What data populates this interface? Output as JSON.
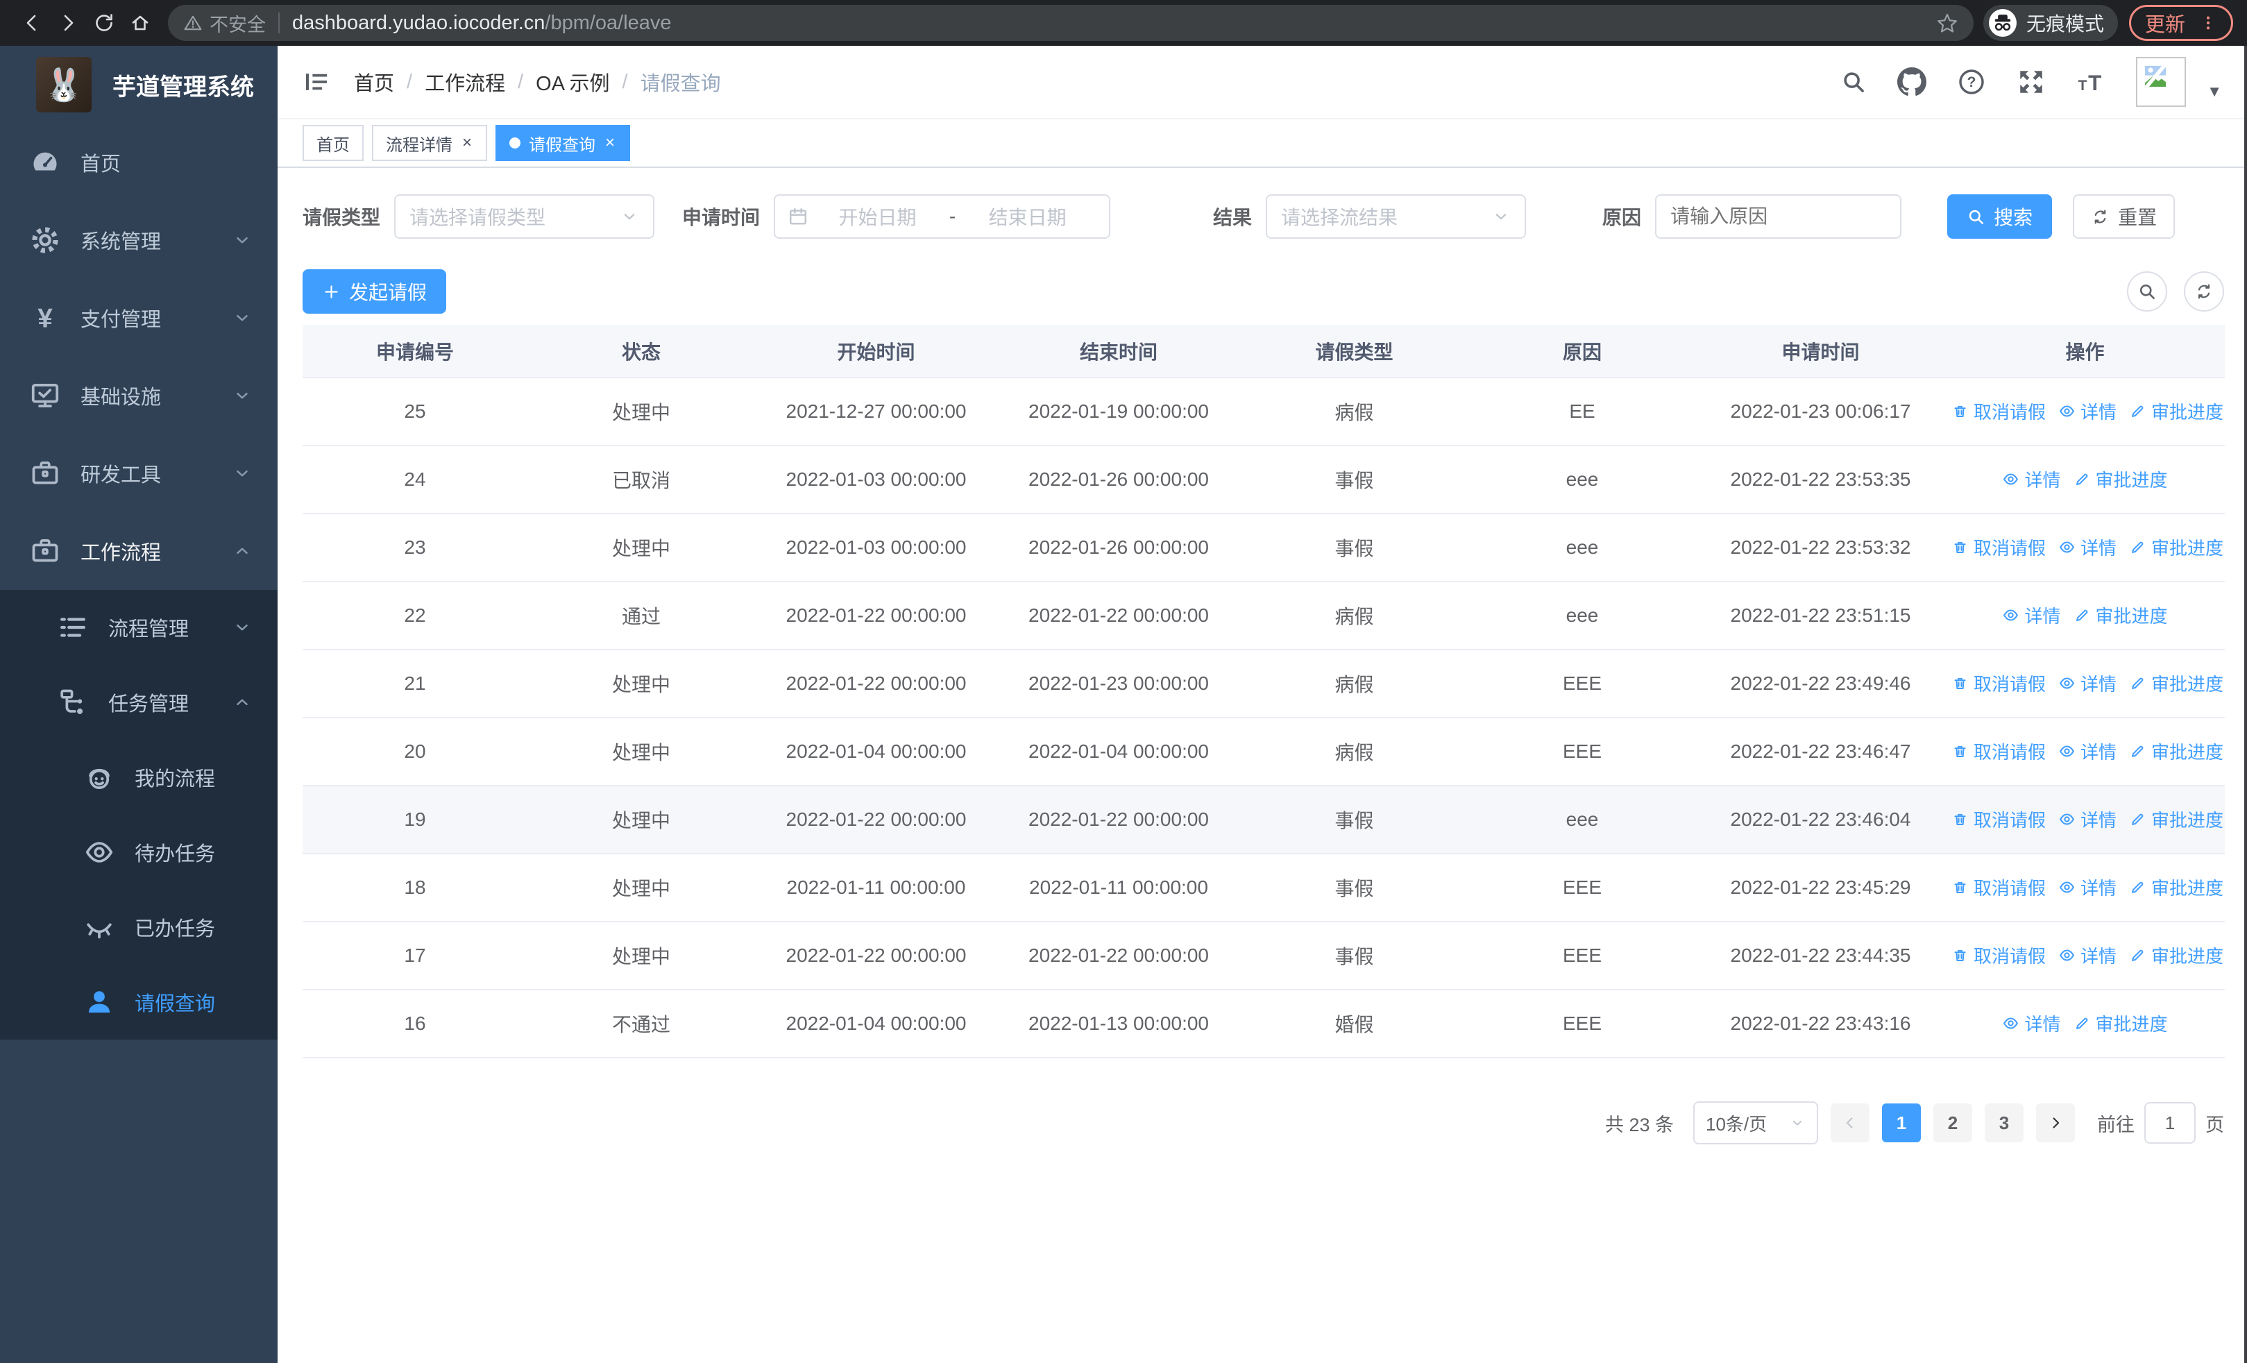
{
  "browser": {
    "security_label": "不安全",
    "url_host": "dashboard.yudao.iocoder.cn",
    "url_path": "/bpm/oa/leave",
    "incognito_label": "无痕模式",
    "update_label": "更新"
  },
  "sidebar": {
    "title": "芋道管理系统",
    "items": [
      {
        "name": "home",
        "label": "首页",
        "icon": "dashboard",
        "level": 0
      },
      {
        "name": "system-management",
        "label": "系统管理",
        "icon": "gear",
        "level": 0,
        "chevron": "down"
      },
      {
        "name": "payment-management",
        "label": "支付管理",
        "icon": "yen",
        "level": 0,
        "chevron": "down"
      },
      {
        "name": "infrastructure",
        "label": "基础设施",
        "icon": "monitor",
        "level": 0,
        "chevron": "down"
      },
      {
        "name": "dev-tools",
        "label": "研发工具",
        "icon": "briefcase",
        "level": 0,
        "chevron": "down"
      },
      {
        "name": "workflow",
        "label": "工作流程",
        "icon": "briefcase",
        "level": 0,
        "chevron": "up",
        "active_parent": true
      },
      {
        "name": "process-management",
        "label": "流程管理",
        "icon": "list",
        "level": 1,
        "chevron": "down"
      },
      {
        "name": "task-management",
        "label": "任务管理",
        "icon": "tree",
        "level": 1,
        "chevron": "up"
      },
      {
        "name": "my-process",
        "label": "我的流程",
        "icon": "face",
        "level": 2
      },
      {
        "name": "todo-tasks",
        "label": "待办任务",
        "icon": "eye",
        "level": 2
      },
      {
        "name": "done-tasks",
        "label": "已办任务",
        "icon": "eye-off",
        "level": 2
      },
      {
        "name": "leave-query",
        "label": "请假查询",
        "icon": "user",
        "level": 2,
        "active": true
      }
    ]
  },
  "header": {
    "breadcrumb": [
      "首页",
      "工作流程",
      "OA 示例",
      "请假查询"
    ]
  },
  "tabs": [
    {
      "name": "home",
      "label": "首页",
      "closable": false,
      "active": false
    },
    {
      "name": "process-detail",
      "label": "流程详情",
      "closable": true,
      "active": false
    },
    {
      "name": "leave-query",
      "label": "请假查询",
      "closable": true,
      "active": true
    }
  ],
  "filters": {
    "leave_type_label": "请假类型",
    "leave_type_placeholder": "请选择请假类型",
    "apply_time_label": "申请时间",
    "start_placeholder": "开始日期",
    "range_separator": "-",
    "end_placeholder": "结束日期",
    "result_label": "结果",
    "result_placeholder": "请选择流结果",
    "reason_label": "原因",
    "reason_placeholder": "请输入原因",
    "search_label": "搜索",
    "reset_label": "重置"
  },
  "toolbar": {
    "create_label": "发起请假"
  },
  "table": {
    "columns": [
      "申请编号",
      "状态",
      "开始时间",
      "结束时间",
      "请假类型",
      "原因",
      "申请时间",
      "操作"
    ],
    "action_labels": {
      "cancel": "取消请假",
      "detail": "详情",
      "progress": "审批进度"
    },
    "rows": [
      {
        "id": "25",
        "status": "处理中",
        "start_time": "2021-12-27 00:00:00",
        "end_time": "2022-01-19 00:00:00",
        "leave_type": "病假",
        "reason": "EE",
        "apply_time": "2022-01-23 00:06:17",
        "actions": [
          "cancel",
          "detail",
          "progress"
        ]
      },
      {
        "id": "24",
        "status": "已取消",
        "start_time": "2022-01-03 00:00:00",
        "end_time": "2022-01-26 00:00:00",
        "leave_type": "事假",
        "reason": "eee",
        "apply_time": "2022-01-22 23:53:35",
        "actions": [
          "detail",
          "progress"
        ]
      },
      {
        "id": "23",
        "status": "处理中",
        "start_time": "2022-01-03 00:00:00",
        "end_time": "2022-01-26 00:00:00",
        "leave_type": "事假",
        "reason": "eee",
        "apply_time": "2022-01-22 23:53:32",
        "actions": [
          "cancel",
          "detail",
          "progress"
        ]
      },
      {
        "id": "22",
        "status": "通过",
        "start_time": "2022-01-22 00:00:00",
        "end_time": "2022-01-22 00:00:00",
        "leave_type": "病假",
        "reason": "eee",
        "apply_time": "2022-01-22 23:51:15",
        "actions": [
          "detail",
          "progress"
        ]
      },
      {
        "id": "21",
        "status": "处理中",
        "start_time": "2022-01-22 00:00:00",
        "end_time": "2022-01-23 00:00:00",
        "leave_type": "病假",
        "reason": "EEE",
        "apply_time": "2022-01-22 23:49:46",
        "actions": [
          "cancel",
          "detail",
          "progress"
        ]
      },
      {
        "id": "20",
        "status": "处理中",
        "start_time": "2022-01-04 00:00:00",
        "end_time": "2022-01-04 00:00:00",
        "leave_type": "病假",
        "reason": "EEE",
        "apply_time": "2022-01-22 23:46:47",
        "actions": [
          "cancel",
          "detail",
          "progress"
        ]
      },
      {
        "id": "19",
        "status": "处理中",
        "start_time": "2022-01-22 00:00:00",
        "end_time": "2022-01-22 00:00:00",
        "leave_type": "事假",
        "reason": "eee",
        "apply_time": "2022-01-22 23:46:04",
        "actions": [
          "cancel",
          "detail",
          "progress"
        ],
        "highlight": true
      },
      {
        "id": "18",
        "status": "处理中",
        "start_time": "2022-01-11 00:00:00",
        "end_time": "2022-01-11 00:00:00",
        "leave_type": "事假",
        "reason": "EEE",
        "apply_time": "2022-01-22 23:45:29",
        "actions": [
          "cancel",
          "detail",
          "progress"
        ]
      },
      {
        "id": "17",
        "status": "处理中",
        "start_time": "2022-01-22 00:00:00",
        "end_time": "2022-01-22 00:00:00",
        "leave_type": "事假",
        "reason": "EEE",
        "apply_time": "2022-01-22 23:44:35",
        "actions": [
          "cancel",
          "detail",
          "progress"
        ]
      },
      {
        "id": "16",
        "status": "不通过",
        "start_time": "2022-01-04 00:00:00",
        "end_time": "2022-01-13 00:00:00",
        "leave_type": "婚假",
        "reason": "EEE",
        "apply_time": "2022-01-22 23:43:16",
        "actions": [
          "detail",
          "progress"
        ]
      }
    ]
  },
  "pagination": {
    "total_label": "共 23 条",
    "page_size_value": "10条/页",
    "pages": [
      "1",
      "2",
      "3"
    ],
    "active_page": "1",
    "goto_label": "前往",
    "goto_value": "1",
    "page_unit_label": "页"
  }
}
